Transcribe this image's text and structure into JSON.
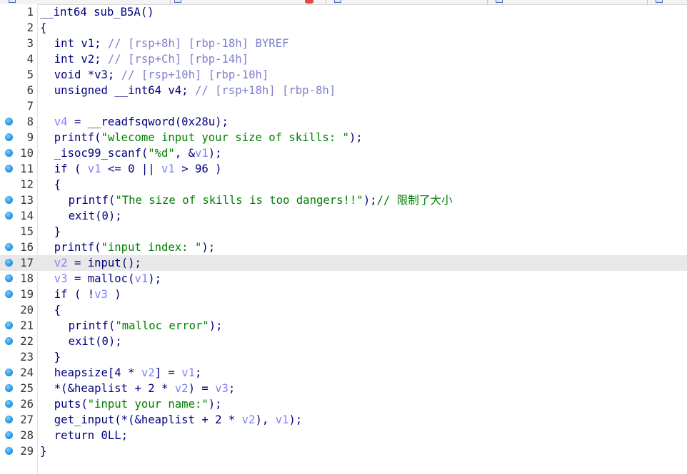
{
  "window": {
    "accent": "#e2483d",
    "code_color": "#000080",
    "comment_color": "#7f7fd0",
    "string_color": "#008000",
    "local_var_color": "#8080ff",
    "current_line_bg": "#e8e8e8",
    "breakpoint_color": "#2a9be6"
  },
  "editor": {
    "current_line": 17,
    "lines": [
      {
        "n": "1",
        "bp": false,
        "indent": 0,
        "parts": [
          [
            "plain",
            "__int64 sub_B5A()"
          ]
        ]
      },
      {
        "n": "2",
        "bp": false,
        "indent": 0,
        "parts": [
          [
            "plain",
            "{"
          ]
        ]
      },
      {
        "n": "3",
        "bp": false,
        "indent": 2,
        "parts": [
          [
            "plain",
            "int v1; "
          ],
          [
            "cmt",
            "// [rsp+8h] [rbp-18h] BYREF"
          ]
        ]
      },
      {
        "n": "4",
        "bp": false,
        "indent": 2,
        "parts": [
          [
            "plain",
            "int v2; "
          ],
          [
            "cmt",
            "// [rsp+Ch] [rbp-14h]"
          ]
        ]
      },
      {
        "n": "5",
        "bp": false,
        "indent": 2,
        "parts": [
          [
            "plain",
            "void *v3; "
          ],
          [
            "cmt",
            "// [rsp+10h] [rbp-10h]"
          ]
        ]
      },
      {
        "n": "6",
        "bp": false,
        "indent": 2,
        "parts": [
          [
            "plain",
            "unsigned __int64 v4; "
          ],
          [
            "cmt",
            "// [rsp+18h] [rbp-8h]"
          ]
        ]
      },
      {
        "n": "7",
        "bp": false,
        "indent": 0,
        "parts": []
      },
      {
        "n": "8",
        "bp": true,
        "indent": 2,
        "parts": [
          [
            "var",
            "v4"
          ],
          [
            "plain",
            " = __readfsqword(0x28u);"
          ]
        ]
      },
      {
        "n": "9",
        "bp": true,
        "indent": 2,
        "parts": [
          [
            "plain",
            "printf("
          ],
          [
            "str",
            "\"wlecome input your size of skills: \""
          ],
          [
            "plain",
            ");"
          ]
        ]
      },
      {
        "n": "10",
        "bp": true,
        "indent": 2,
        "parts": [
          [
            "plain",
            "_isoc99_scanf("
          ],
          [
            "str",
            "\"%d\""
          ],
          [
            "plain",
            ", &"
          ],
          [
            "var",
            "v1"
          ],
          [
            "plain",
            ");"
          ]
        ]
      },
      {
        "n": "11",
        "bp": true,
        "indent": 2,
        "parts": [
          [
            "plain",
            "if ( "
          ],
          [
            "var",
            "v1"
          ],
          [
            "plain",
            " <= 0 || "
          ],
          [
            "var",
            "v1"
          ],
          [
            "plain",
            " > 96 )"
          ]
        ]
      },
      {
        "n": "12",
        "bp": false,
        "indent": 2,
        "parts": [
          [
            "plain",
            "{"
          ]
        ]
      },
      {
        "n": "13",
        "bp": true,
        "indent": 4,
        "parts": [
          [
            "plain",
            "printf("
          ],
          [
            "str",
            "\"The size of skills is too dangers!!\""
          ],
          [
            "plain",
            ");"
          ],
          [
            "cn",
            "// 限制了大小"
          ]
        ]
      },
      {
        "n": "14",
        "bp": true,
        "indent": 4,
        "parts": [
          [
            "plain",
            "exit(0);"
          ]
        ]
      },
      {
        "n": "15",
        "bp": false,
        "indent": 2,
        "parts": [
          [
            "plain",
            "}"
          ]
        ]
      },
      {
        "n": "16",
        "bp": true,
        "indent": 2,
        "parts": [
          [
            "plain",
            "printf("
          ],
          [
            "str",
            "\"input index: \""
          ],
          [
            "plain",
            ");"
          ]
        ]
      },
      {
        "n": "17",
        "bp": true,
        "indent": 2,
        "parts": [
          [
            "var",
            "v2"
          ],
          [
            "plain",
            " = input();"
          ]
        ]
      },
      {
        "n": "18",
        "bp": true,
        "indent": 2,
        "parts": [
          [
            "var",
            "v3"
          ],
          [
            "plain",
            " = malloc("
          ],
          [
            "var",
            "v1"
          ],
          [
            "plain",
            ");"
          ]
        ]
      },
      {
        "n": "19",
        "bp": true,
        "indent": 2,
        "parts": [
          [
            "plain",
            "if ( !"
          ],
          [
            "var",
            "v3"
          ],
          [
            "plain",
            " )"
          ]
        ]
      },
      {
        "n": "20",
        "bp": false,
        "indent": 2,
        "parts": [
          [
            "plain",
            "{"
          ]
        ]
      },
      {
        "n": "21",
        "bp": true,
        "indent": 4,
        "parts": [
          [
            "plain",
            "printf("
          ],
          [
            "str",
            "\"malloc error\""
          ],
          [
            "plain",
            ");"
          ]
        ]
      },
      {
        "n": "22",
        "bp": true,
        "indent": 4,
        "parts": [
          [
            "plain",
            "exit(0);"
          ]
        ]
      },
      {
        "n": "23",
        "bp": false,
        "indent": 2,
        "parts": [
          [
            "plain",
            "}"
          ]
        ]
      },
      {
        "n": "24",
        "bp": true,
        "indent": 2,
        "parts": [
          [
            "plain",
            "heapsize[4 * "
          ],
          [
            "var",
            "v2"
          ],
          [
            "plain",
            "] = "
          ],
          [
            "var",
            "v1"
          ],
          [
            "plain",
            ";"
          ]
        ]
      },
      {
        "n": "25",
        "bp": true,
        "indent": 2,
        "parts": [
          [
            "plain",
            "*(&heaplist + 2 * "
          ],
          [
            "var",
            "v2"
          ],
          [
            "plain",
            ") = "
          ],
          [
            "var",
            "v3"
          ],
          [
            "plain",
            ";"
          ]
        ]
      },
      {
        "n": "26",
        "bp": true,
        "indent": 2,
        "parts": [
          [
            "plain",
            "puts("
          ],
          [
            "str",
            "\"input your name:\""
          ],
          [
            "plain",
            ");"
          ]
        ]
      },
      {
        "n": "27",
        "bp": true,
        "indent": 2,
        "parts": [
          [
            "plain",
            "get_input(*(&heaplist + 2 * "
          ],
          [
            "var",
            "v2"
          ],
          [
            "plain",
            "), "
          ],
          [
            "var",
            "v1"
          ],
          [
            "plain",
            ");"
          ]
        ]
      },
      {
        "n": "28",
        "bp": true,
        "indent": 2,
        "parts": [
          [
            "plain",
            "return 0LL;"
          ]
        ]
      },
      {
        "n": "29",
        "bp": true,
        "indent": 0,
        "parts": [
          [
            "plain",
            "}"
          ]
        ]
      }
    ]
  }
}
